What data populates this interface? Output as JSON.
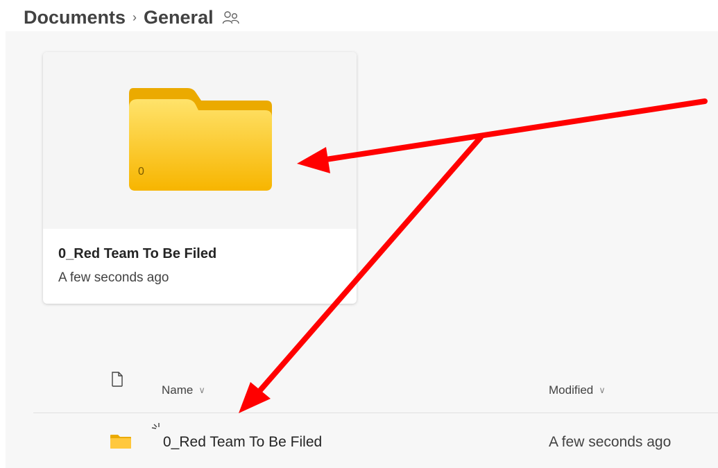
{
  "breadcrumb": {
    "root": "Documents",
    "separator": "›",
    "current": "General",
    "shared_icon": "people-icon"
  },
  "card": {
    "folder_icon": "folder-icon",
    "item_count": "0",
    "name": "0_Red Team To Be Filed",
    "modified": "A few seconds ago"
  },
  "list": {
    "header": {
      "type_icon": "document-icon",
      "name_label": "Name",
      "modified_label": "Modified",
      "sort_icon": "chevron-down-icon"
    },
    "rows": [
      {
        "icon": "folder-icon",
        "name": "0_Red Team To Be Filed",
        "modified": "A few seconds ago",
        "new_indicator": "sparkle-icon"
      }
    ]
  },
  "colors": {
    "folder_light": "#FFD54F",
    "folder_dark": "#F5B400",
    "annotation_arrow": "#FF0000",
    "background": "#F7F7F7"
  }
}
